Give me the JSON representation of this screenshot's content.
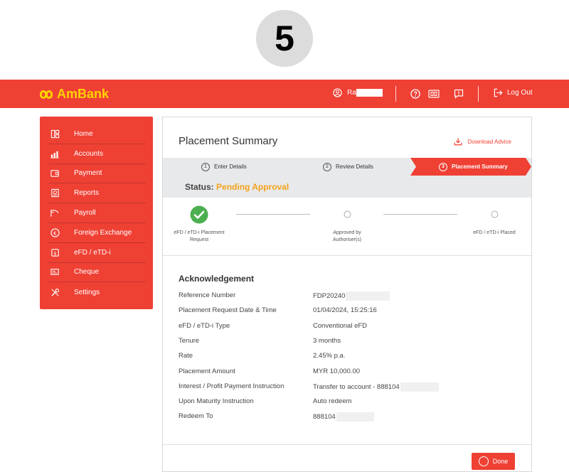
{
  "step_number": "5",
  "header": {
    "brand": "AmBank",
    "user_name": "Ra",
    "logout_label": "Log Out",
    "icons": [
      "user-icon",
      "help-icon",
      "video-call-icon",
      "feedback-icon",
      "logout-icon"
    ]
  },
  "sidebar": {
    "items": [
      {
        "label": "Home",
        "icon": "home-icon"
      },
      {
        "label": "Accounts",
        "icon": "accounts-icon"
      },
      {
        "label": "Payment",
        "icon": "payment-icon"
      },
      {
        "label": "Reports",
        "icon": "reports-icon"
      },
      {
        "label": "Payroll",
        "icon": "payroll-icon"
      },
      {
        "label": "Foreign Exchange",
        "icon": "foreign-exchange-icon"
      },
      {
        "label": "eFD / eTD-i",
        "icon": "efd-icon"
      },
      {
        "label": "Cheque",
        "icon": "cheque-icon"
      },
      {
        "label": "Settings",
        "icon": "settings-icon"
      }
    ]
  },
  "main": {
    "title": "Placement Summary",
    "download_label": "Download Advice",
    "steps": [
      {
        "num": "1",
        "label": "Enter Details"
      },
      {
        "num": "2",
        "label": "Review Details"
      },
      {
        "num": "3",
        "label": "Placement Summary"
      }
    ],
    "status_label": "Status:",
    "status_value": "Pending Approval",
    "progress": [
      {
        "label_line1": "eFD / eTD-i Placement",
        "label_line2": "Request",
        "done": true
      },
      {
        "label_line1": "Approved by",
        "label_line2": "Authoriser(s)",
        "done": false
      },
      {
        "label_line1": "eFD / eTD-i Placed",
        "label_line2": "",
        "done": false
      }
    ],
    "acknowledgement": {
      "title": "Acknowledgement",
      "rows": [
        {
          "key": "Reference Number",
          "value": "FDP20240"
        },
        {
          "key": "Placement Request Date & Time",
          "value": "01/04/2024, 15:25:16"
        },
        {
          "key": "eFD / eTD-i Type",
          "value": "Conventional eFD"
        },
        {
          "key": "Tenure",
          "value": "3 months"
        },
        {
          "key": "Rate",
          "value": "2.45% p.a."
        },
        {
          "key": "Placement Amount",
          "value": "MYR 10,000.00"
        },
        {
          "key": "Interest / Profit Payment Instruction",
          "value": "Transfer to account - 888104"
        },
        {
          "key": "Upon Maturity Instruction",
          "value": "Auto redeem"
        },
        {
          "key": "Redeem To",
          "value": "888104"
        }
      ]
    },
    "done_label": "Done"
  },
  "colors": {
    "brand_red": "#ef4034",
    "brand_yellow": "#ffd200",
    "status_orange": "#f5a31a",
    "success_green": "#4caf50"
  }
}
